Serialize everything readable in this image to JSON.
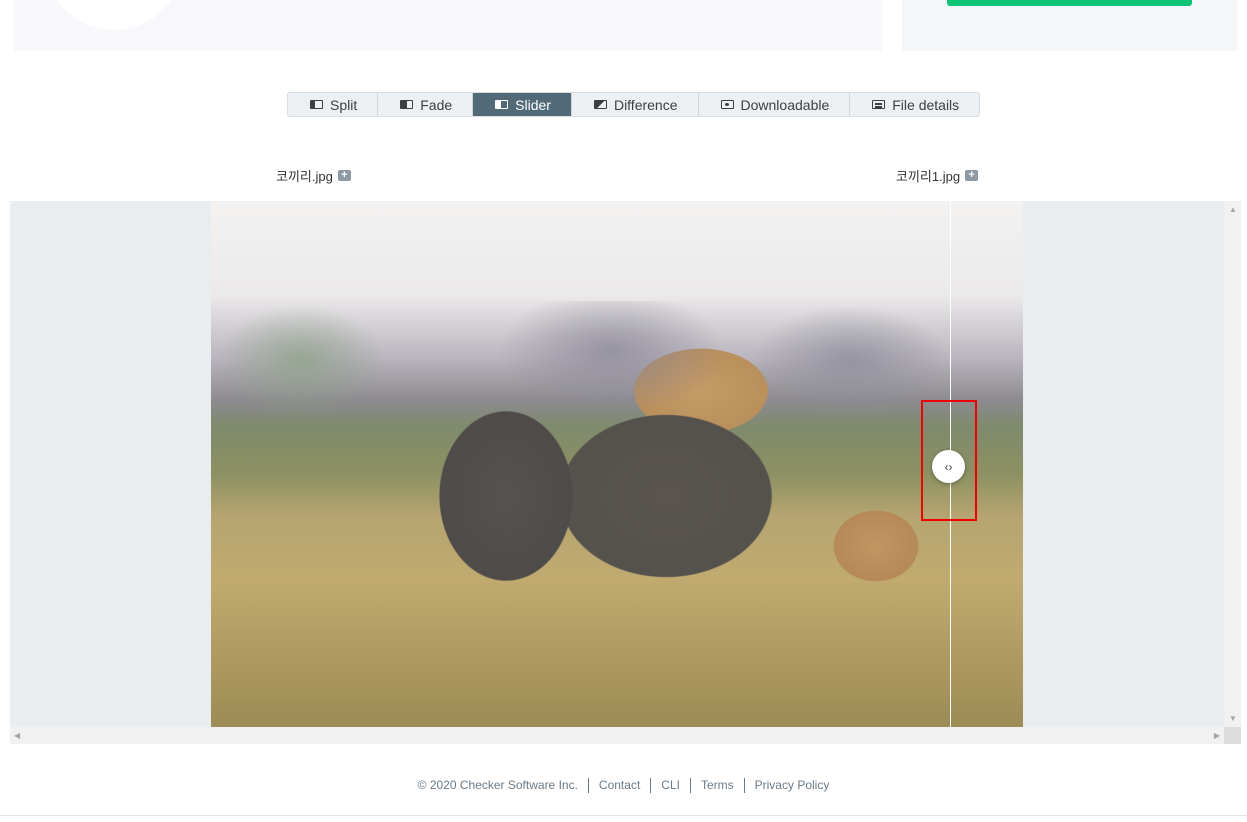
{
  "tabs": [
    {
      "label": "Split",
      "icon": "split-icon"
    },
    {
      "label": "Fade",
      "icon": "fade-icon"
    },
    {
      "label": "Slider",
      "icon": "slider-icon",
      "active": true
    },
    {
      "label": "Difference",
      "icon": "difference-icon"
    },
    {
      "label": "Downloadable",
      "icon": "downloadable-icon"
    },
    {
      "label": "File details",
      "icon": "file-details-icon"
    }
  ],
  "files": {
    "left": "코끼리.jpg",
    "right": "코끼리1.jpg"
  },
  "slider": {
    "handle_glyph": "‹›"
  },
  "footer": {
    "copyright": "© 2020 Checker Software Inc.",
    "links": [
      "Contact",
      "CLI",
      "Terms",
      "Privacy Policy"
    ]
  },
  "colors": {
    "accent_green": "#0fc477",
    "active_tab": "#526a78",
    "highlight": "#ee0000"
  }
}
